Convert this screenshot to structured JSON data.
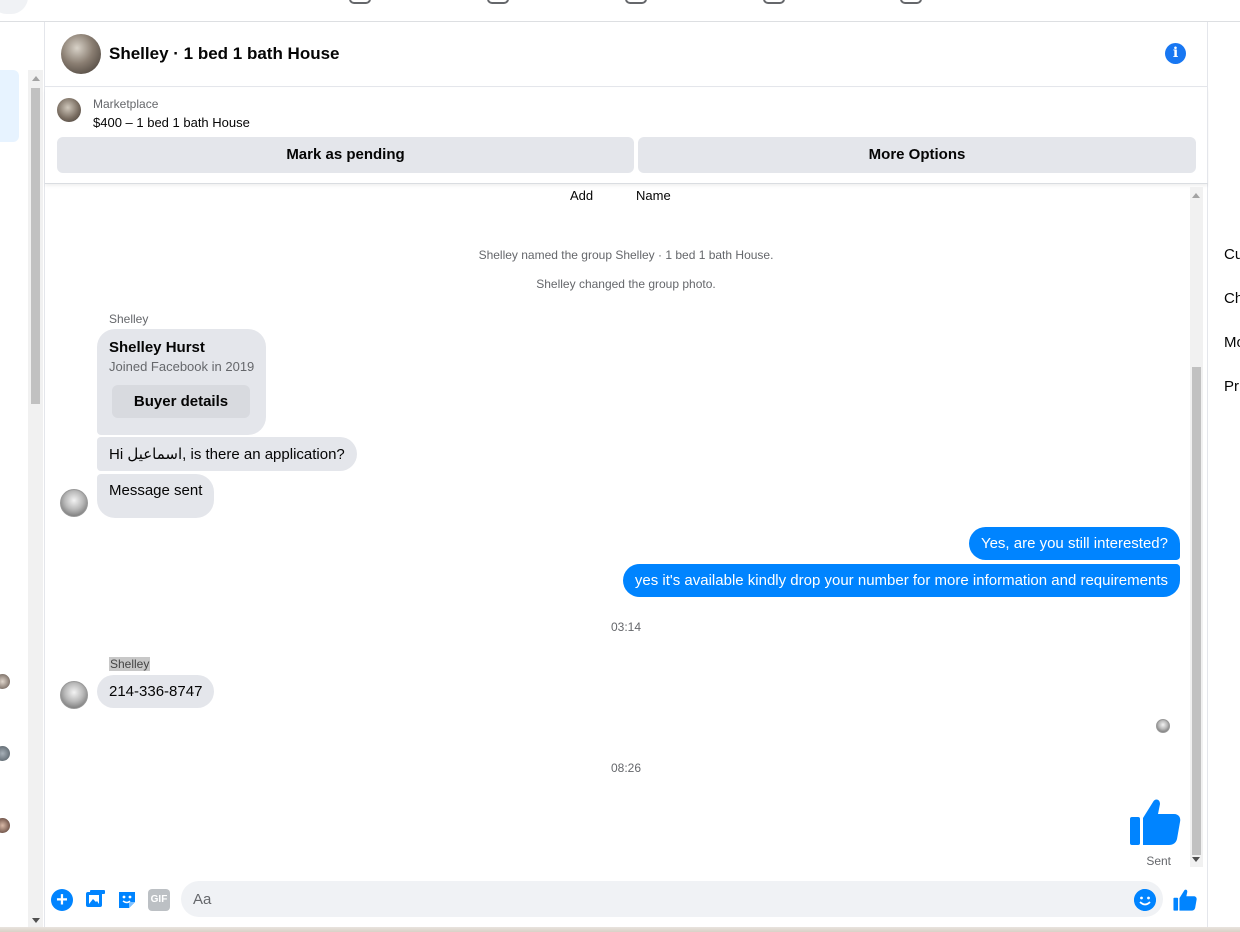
{
  "header": {
    "title": "Shelley · 1 bed 1 bath House"
  },
  "marketplace": {
    "label": "Marketplace",
    "listing": "$400 – 1 bed 1 bath House",
    "pending_button": "Mark as pending",
    "options_button": "More Options"
  },
  "thread": {
    "actions": [
      "Add",
      "Name"
    ],
    "events": [
      "Shelley named the group Shelley · 1 bed 1 bath House.",
      "Shelley changed the group photo."
    ],
    "sender_name": "Shelley",
    "profile_card": {
      "name": "Shelley Hurst",
      "joined": "Joined Facebook in 2019",
      "button": "Buyer details"
    },
    "incoming_1": "Hi اسماعيل, is there an application?",
    "incoming_2": "Message sent",
    "outgoing_1": "Yes, are you still interested?",
    "outgoing_2": "yes it's available kindly drop your number for more information and requirements",
    "timestamp_1": "03:14",
    "incoming_3": "214-336-8747",
    "timestamp_2": "08:26",
    "sent_status": "Sent"
  },
  "composer": {
    "placeholder": "Aa",
    "gif_label": "GIF",
    "icons": [
      "plus-icon",
      "photo-icon",
      "sticker-icon",
      "gif-icon",
      "emoji-icon",
      "thumbs-up-icon"
    ]
  },
  "right_menu": {
    "items": [
      "Cu",
      "Ch",
      "Mo",
      "Pri"
    ]
  },
  "colors": {
    "accent": "#0084ff",
    "brand": "#1877f2",
    "bubble_in": "#e4e6eb",
    "secondary_text": "#65676b"
  }
}
